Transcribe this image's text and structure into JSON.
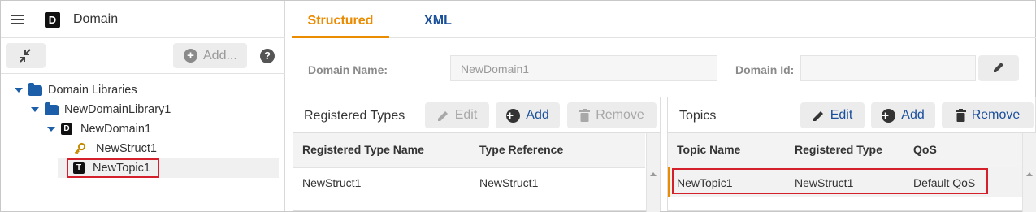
{
  "left_panel": {
    "title": "Domain",
    "add_label": "Add...",
    "help_label": "?",
    "tree": [
      {
        "label": "Domain Libraries"
      },
      {
        "label": "NewDomainLibrary1"
      },
      {
        "label": "NewDomain1"
      },
      {
        "label": "NewStruct1"
      },
      {
        "label": "NewTopic1"
      }
    ],
    "selected_item": "NewTopic1"
  },
  "tabs": [
    {
      "label": "Structured",
      "active": true
    },
    {
      "label": "XML",
      "active": false
    }
  ],
  "domain_form": {
    "name_label": "Domain Name:",
    "name_value": "NewDomain1",
    "id_label": "Domain Id:",
    "id_value": ""
  },
  "registered_types": {
    "title": "Registered Types",
    "buttons": {
      "edit": "Edit",
      "add": "Add",
      "remove": "Remove"
    },
    "columns": [
      "Registered Type Name",
      "Type Reference"
    ],
    "rows": [
      [
        "NewStruct1",
        "NewStruct1"
      ]
    ]
  },
  "topics": {
    "title": "Topics",
    "buttons": {
      "edit": "Edit",
      "add": "Add",
      "remove": "Remove"
    },
    "columns": [
      "Topic Name",
      "Registered Type",
      "QoS"
    ],
    "rows": [
      [
        "NewTopic1",
        "NewStruct1",
        "Default QoS"
      ]
    ]
  },
  "colors": {
    "accent_orange": "#ea8b00",
    "accent_blue": "#1a4f9c",
    "folder_blue": "#1c5fa8",
    "highlight_red": "#d4202a"
  },
  "icons": [
    "menu-icon",
    "domain-icon",
    "collapse-icon",
    "plus-circle-icon",
    "help-icon",
    "folder-open-icon",
    "key-icon",
    "topic-icon",
    "pencil-icon",
    "trash-icon"
  ]
}
